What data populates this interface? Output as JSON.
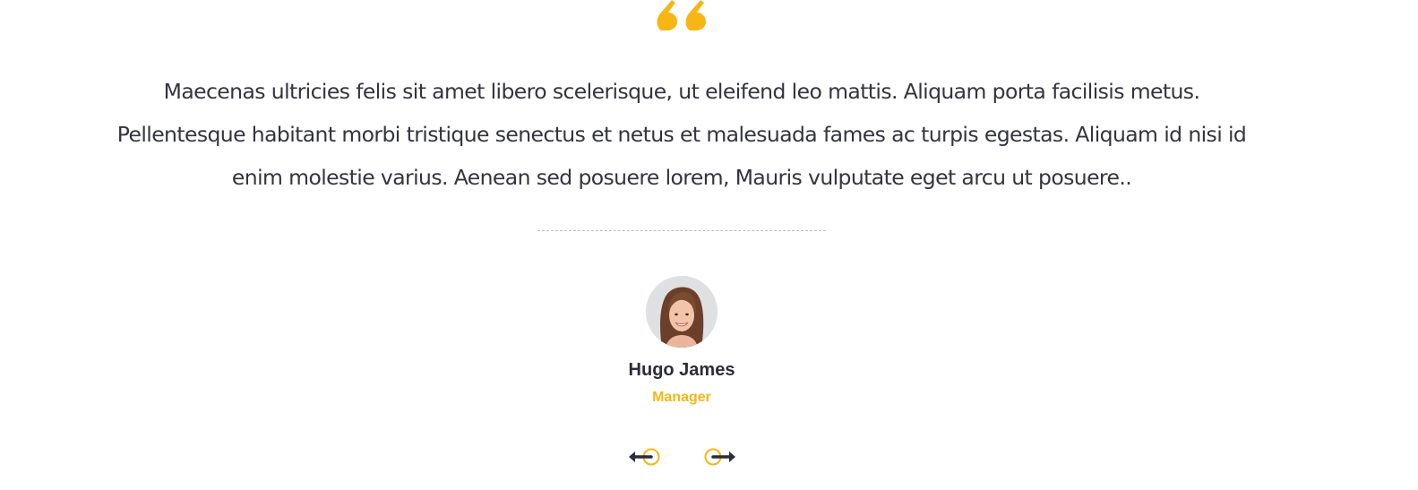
{
  "testimonial": {
    "quote_icon": "double-quote-icon",
    "text": "Maecenas ultricies felis sit amet libero scelerisque, ut eleifend leo mattis. Aliquam porta facilisis metus. Pellentesque habitant morbi tristique senectus et netus et malesuada fames ac turpis egestas. Aliquam id nisi id enim molestie varius. Aenean sed posuere lorem, Mauris vulputate eget arcu ut posuere..",
    "author": {
      "name": "Hugo James",
      "role": "Manager",
      "avatar": "avatar-photo"
    }
  },
  "navigation": {
    "prev_icon": "arrow-left-icon",
    "next_icon": "arrow-right-icon"
  },
  "colors": {
    "accent": "#f7b614",
    "text_dark": "#2b2d3a",
    "divider": "#bdbdbd"
  }
}
